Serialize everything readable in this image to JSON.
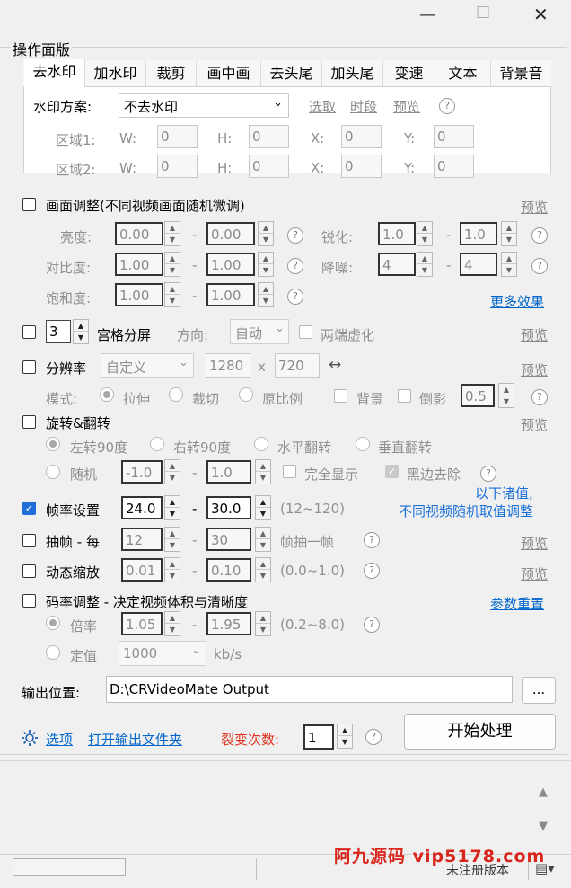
{
  "window": {
    "minimize": "—",
    "maximize": "☐",
    "close": "✕"
  },
  "panel_title": "操作面版",
  "tabs": [
    "去水印",
    "加水印",
    "裁剪",
    "画中画",
    "去头尾",
    "加头尾",
    "变速",
    "文本",
    "背景音"
  ],
  "watermark": {
    "scheme_label": "水印方案:",
    "scheme_value": "不去水印",
    "pick": "选取",
    "period": "时段",
    "preview": "预览",
    "region1": "区域1:",
    "region2": "区域2:",
    "w": "W:",
    "h": "H:",
    "x": "X:",
    "y": "Y:",
    "zero": "0"
  },
  "picture": {
    "label": "画面调整(不同视频画面随机微调)",
    "preview": "预览",
    "brightness": "亮度:",
    "contrast": "对比度:",
    "saturation": "饱和度:",
    "b1": "0.00",
    "b2": "0.00",
    "c1": "1.00",
    "c2": "1.00",
    "s1": "1.00",
    "s2": "1.00",
    "sharpen": "锐化:",
    "sh1": "1.0",
    "sh2": "1.0",
    "denoise": "降噪:",
    "dn1": "4",
    "dn2": "4",
    "more": "更多效果"
  },
  "grid": {
    "value": "3",
    "label": "宫格分屏",
    "dir_label": "方向:",
    "dir_value": "自动",
    "blur": "两端虚化",
    "preview": "预览"
  },
  "resolution": {
    "label": "分辨率",
    "preset": "自定义",
    "width": "1280",
    "x": "x",
    "height": "720",
    "swap": "↔",
    "preview": "预览",
    "mode_label": "模式:",
    "stretch": "拉伸",
    "crop": "裁切",
    "ratio": "原比例",
    "bg": "背景",
    "reflection": "倒影",
    "reflect_val": "0.5"
  },
  "rotate": {
    "label": "旋转&翻转",
    "preview": "预览",
    "left90": "左转90度",
    "right90": "右转90度",
    "hflip": "水平翻转",
    "vflip": "垂直翻转",
    "random": "随机",
    "r1": "-1.0",
    "r2": "1.0",
    "full": "完全显示",
    "blackedge": "黑边去除"
  },
  "note": {
    "line1": "以下诸值,",
    "line2": "不同视频随机取值调整"
  },
  "framerate": {
    "label": "帧率设置",
    "v1": "24.0",
    "v2": "30.0",
    "range": "(12~120)"
  },
  "drop": {
    "label": "抽帧 - 每",
    "v1": "12",
    "v2": "30",
    "suffix": "帧抽一帧",
    "preview": "预览"
  },
  "zoom": {
    "label": "动态缩放",
    "v1": "0.01",
    "v2": "0.10",
    "range": "(0.0~1.0)",
    "preview": "预览"
  },
  "bitrate": {
    "label": "码率调整 - 决定视频体积与清晰度",
    "reset": "参数重置",
    "mult": "倍率",
    "m1": "1.05",
    "m2": "1.95",
    "range": "(0.2~8.0)",
    "fixed": "定值",
    "fixed_val": "1000",
    "unit": "kb/s"
  },
  "output": {
    "label": "输出位置:",
    "path": "D:\\CRVideoMate Output",
    "browse": "..."
  },
  "bottom": {
    "options": "选项",
    "open_folder": "打开输出文件夹",
    "split_label": "裂变次数:",
    "split_val": "1",
    "start": "开始处理"
  },
  "status": {
    "unregistered": "未注册版本",
    "watermark": "阿九源码 vip5178.com"
  },
  "dash": "-",
  "help": "?"
}
